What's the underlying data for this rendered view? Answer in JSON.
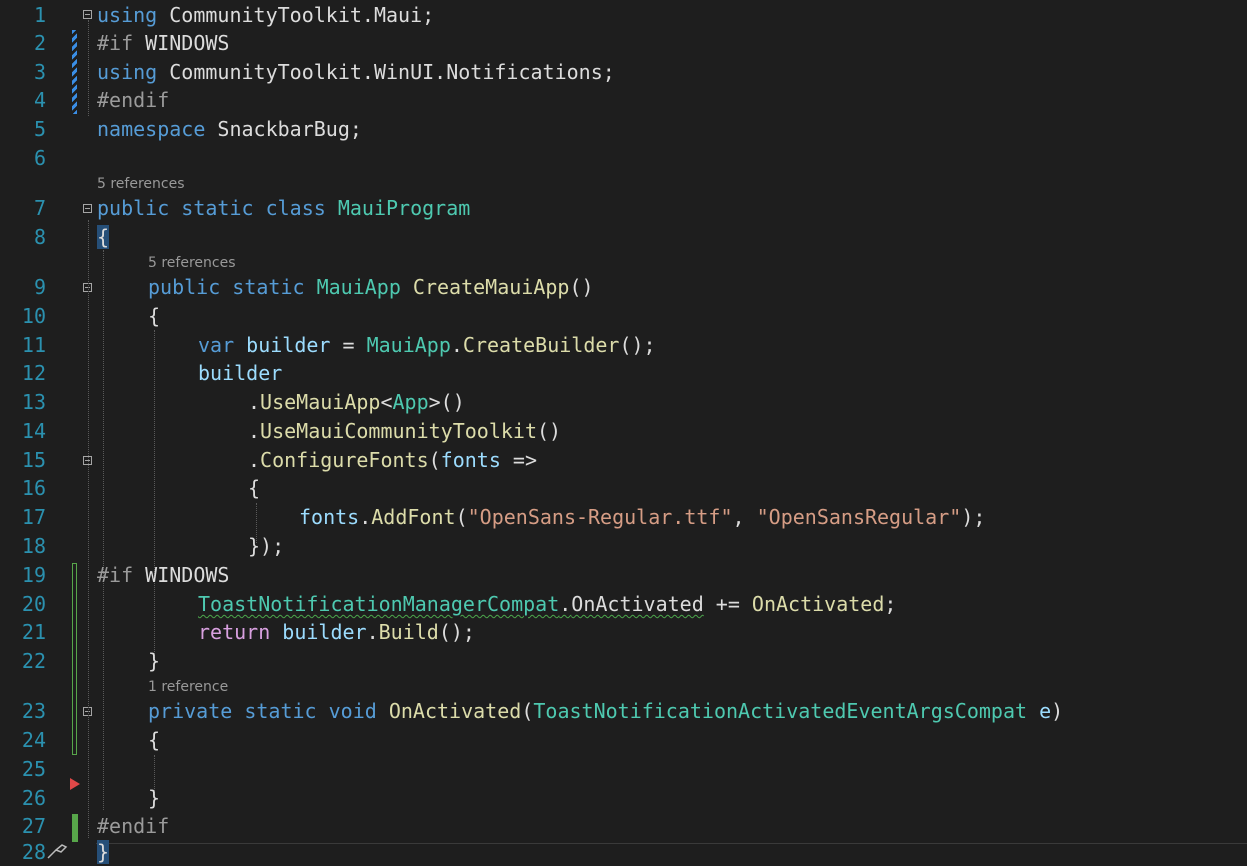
{
  "editor": {
    "line_numbers": [
      "1",
      "2",
      "3",
      "4",
      "5",
      "6",
      "7",
      "8",
      "9",
      "10",
      "11",
      "12",
      "13",
      "14",
      "15",
      "16",
      "17",
      "18",
      "19",
      "20",
      "21",
      "22",
      "23",
      "24",
      "25",
      "26",
      "27",
      "28"
    ],
    "codelens": {
      "ref_class": "5 references",
      "ref_method": "5 references",
      "ref_onactivated": "1 reference"
    },
    "tokens": {
      "l1_using": "using",
      "l1_ns": " CommunityToolkit.Maui;",
      "l2_pre": "#if",
      "l2_sym": " WINDOWS",
      "l3_using": "using",
      "l3_ns": " CommunityToolkit.WinUI.Notifications;",
      "l4_pre": "#endif",
      "l5_kw": "namespace",
      "l5_name": " SnackbarBug;",
      "l7_public": "public",
      "l7_static": " static",
      "l7_class": " class",
      "l7_name": " MauiProgram",
      "l8_brace": "{",
      "l9_public": "public",
      "l9_static": " static",
      "l9_type": " MauiApp",
      "l9_method": " CreateMauiApp",
      "l9_paren": "()",
      "l10_brace": "{",
      "l11_var": "var",
      "l11_builder": " builder",
      "l11_eq": " = ",
      "l11_type": "MauiApp",
      "l11_dot": ".",
      "l11_method": "CreateBuilder",
      "l11_end": "();",
      "l12_builder": "builder",
      "l13_dot": ".",
      "l13_method": "UseMauiApp",
      "l13_lt": "<",
      "l13_type": "App",
      "l13_end": ">()",
      "l14_dot": ".",
      "l14_method": "UseMauiCommunityToolkit",
      "l14_end": "()",
      "l15_dot": ".",
      "l15_method": "ConfigureFonts",
      "l15_paren": "(",
      "l15_param": "fonts",
      "l15_arrow": " =>",
      "l16_brace": "{",
      "l17_param": "fonts",
      "l17_dot": ".",
      "l17_method": "AddFont",
      "l17_paren": "(",
      "l17_str1": "\"OpenSans-Regular.ttf\"",
      "l17_comma": ", ",
      "l17_str2": "\"OpenSansRegular\"",
      "l17_end": ");",
      "l18_end": "});",
      "l19_pre": "#if",
      "l19_sym": " WINDOWS",
      "l20_type": "ToastNotificationManagerCompat",
      "l20_dot": ".",
      "l20_event": "OnActivated",
      "l20_op": " += ",
      "l20_handler": "OnActivated",
      "l20_end": ";",
      "l21_return": "return",
      "l21_builder": " builder",
      "l21_dot": ".",
      "l21_method": "Build",
      "l21_end": "();",
      "l22_brace": "}",
      "l23_private": "private",
      "l23_static": " static",
      "l23_void": " void",
      "l23_method": " OnActivated",
      "l23_paren": "(",
      "l23_type": "ToastNotificationActivatedEventArgsCompat",
      "l23_param": " e",
      "l23_end": ")",
      "l24_brace": "{",
      "l26_brace": "}",
      "l27_pre": "#endif",
      "l28_brace": "}"
    },
    "colors": {
      "background": "#1e1e1e",
      "keyword": "#569cd6",
      "control_keyword": "#d8a0df",
      "type": "#4ec9b0",
      "method": "#dcdcaa",
      "string": "#d69d85",
      "parameter": "#9cdcfe",
      "preprocessor": "#9b9b9b",
      "line_number": "#2b91af"
    }
  }
}
